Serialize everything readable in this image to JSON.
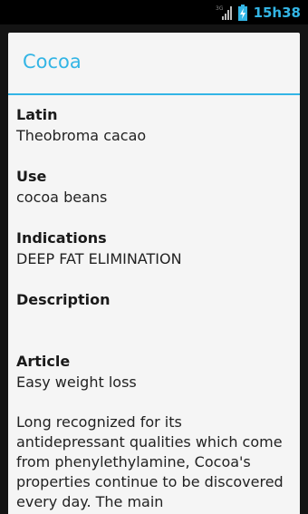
{
  "statusbar": {
    "network_label": "3G",
    "time": "15h38"
  },
  "dialog": {
    "title": "Cocoa",
    "fields": [
      {
        "label": "Latin",
        "value": "Theobroma cacao"
      },
      {
        "label": "Use",
        "value": "cocoa beans"
      },
      {
        "label": "Indications",
        "value": "DEEP FAT ELIMINATION"
      },
      {
        "label": "Description",
        "value": ""
      },
      {
        "label": "Article",
        "value": "Easy weight loss"
      }
    ],
    "article_body": "Long recognized for its antidepressant qualities which come from phenylethylamine, Cocoa's properties continue to be discovered every day. The main"
  },
  "colors": {
    "accent": "#33b5e5",
    "dialog_bg": "#f5f5f5",
    "statusbar_bg": "#000000"
  }
}
